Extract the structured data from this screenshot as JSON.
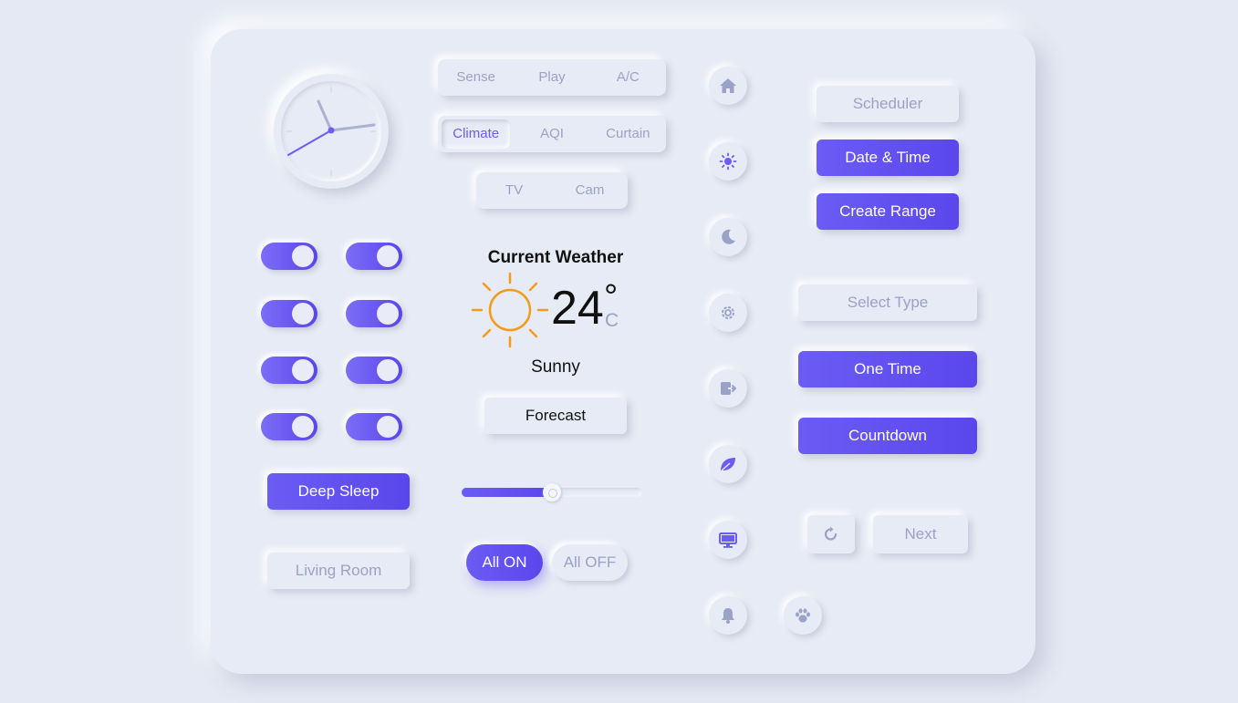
{
  "tabs_row1": [
    "Sense",
    "Play",
    "A/C"
  ],
  "tabs_row2": [
    "Climate",
    "AQI",
    "Curtain"
  ],
  "tabs_row3": [
    "TV",
    "Cam"
  ],
  "weather": {
    "title": "Current Weather",
    "temperature": "24",
    "degree": "°",
    "unit": "C",
    "condition": "Sunny",
    "forecast_button": "Forecast"
  },
  "toggles": [
    true,
    true,
    true,
    true,
    true,
    true,
    true,
    true
  ],
  "buttons": {
    "deep_sleep": "Deep Sleep",
    "living_room": "Living Room",
    "all_on": "All ON",
    "all_off": "All OFF",
    "scheduler": "Scheduler",
    "date_time": "Date & Time",
    "create_range": "Create Range",
    "select_type": "Select Type",
    "one_time": "One Time",
    "countdown": "Countdown",
    "next": "Next"
  },
  "slider": {
    "value_percent": 50
  },
  "icons": [
    "home-icon",
    "sun-icon",
    "moon-icon",
    "settings-icon",
    "logout-icon",
    "leaf-icon",
    "monitor-icon",
    "bell-icon",
    "paw-icon",
    "refresh-icon"
  ],
  "colors": {
    "accent": "#6b5cf5",
    "muted": "#9aa3c7",
    "background": "#e6ebf5",
    "sun": "#f39c1a"
  }
}
